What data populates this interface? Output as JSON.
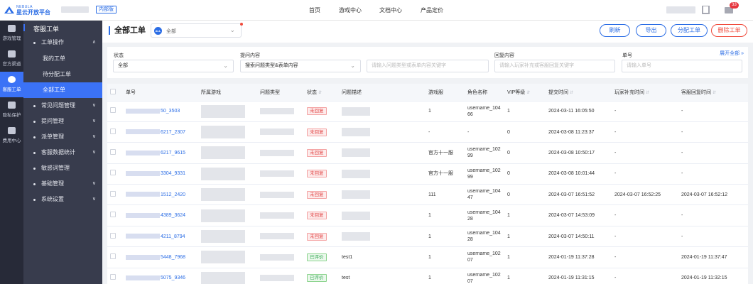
{
  "logo": {
    "line1": "NEBULA",
    "line2": "星云开放平台"
  },
  "top_badge": "内部版",
  "top_nav": [
    "首页",
    "游戏中心",
    "文档中心",
    "产品定价"
  ],
  "notification_count": "33",
  "rail": [
    {
      "label": "游戏管理",
      "icon": "gamepad-icon"
    },
    {
      "label": "官方渠道",
      "icon": "channel-icon"
    },
    {
      "label": "客服工单",
      "icon": "service-icon"
    },
    {
      "label": "隐私保护",
      "icon": "lock-icon"
    },
    {
      "label": "费用中心",
      "icon": "billing-icon"
    }
  ],
  "menu": {
    "title": "客服工单",
    "items": [
      {
        "label": "工单操作",
        "chev": "∧"
      },
      {
        "label": "我的工单",
        "chev": ""
      },
      {
        "label": "待分配工单",
        "chev": ""
      },
      {
        "label": "全部工单",
        "chev": ""
      },
      {
        "label": "常见问题管理",
        "chev": "∨"
      },
      {
        "label": "提问管理",
        "chev": "∨"
      },
      {
        "label": "派单管理",
        "chev": "∨"
      },
      {
        "label": "客服数据统计",
        "chev": "∨"
      },
      {
        "label": "敏感词管理",
        "chev": ""
      },
      {
        "label": "基础管理",
        "chev": "∨"
      },
      {
        "label": "系统设置",
        "chev": "∨"
      }
    ]
  },
  "header": {
    "title": "全部工单",
    "view_icon_text": "ALL",
    "view_value": "全部",
    "buttons": [
      "刷新",
      "导出",
      "分配工单",
      "删除工单"
    ]
  },
  "filters": {
    "expand": "展开全部",
    "status": {
      "label": "状态",
      "value": "全部"
    },
    "question": {
      "label": "提问内容",
      "value": "搜索问题类型&表单内容",
      "placeholder": "请输入问题类型或表单内容关键字"
    },
    "reply": {
      "label": "回复内容",
      "placeholder": "请输入玩家补充或客服回复关键字"
    },
    "order": {
      "label": "单号",
      "placeholder": "请输入单号"
    }
  },
  "table": {
    "columns": [
      "单号",
      "所属游戏",
      "问题类型",
      "状态",
      "问题描述",
      "游戏服",
      "角色名称",
      "VIP等级",
      "提交时间",
      "玩家补充时间",
      "客服回复时间"
    ],
    "rows": [
      {
        "id": "50_3503",
        "status": "未回复",
        "desc": "",
        "server": "1",
        "role": "username_10466",
        "vip": "1",
        "submit": "2024-03-11 16:05:50",
        "supplement": "-",
        "reply": "-"
      },
      {
        "id": "6217_2307",
        "status": "未回复",
        "desc": "",
        "server": "-",
        "role": "-",
        "vip": "0",
        "submit": "2024-03-08 11:23:37",
        "supplement": "-",
        "reply": "-"
      },
      {
        "id": "6217_9615",
        "status": "未回复",
        "desc": "",
        "server": "官方十一服",
        "role": "username_10299",
        "vip": "0",
        "submit": "2024-03-08 10:50:17",
        "supplement": "-",
        "reply": "-"
      },
      {
        "id": "3304_9331",
        "status": "未回复",
        "desc": "",
        "server": "官方十一服",
        "role": "username_10299",
        "vip": "0",
        "submit": "2024-03-08 10:01:44",
        "supplement": "-",
        "reply": "-"
      },
      {
        "id": "1512_2420",
        "status": "未回复",
        "desc": "",
        "server": "111",
        "role": "username_10447",
        "vip": "0",
        "submit": "2024-03-07 16:51:52",
        "supplement": "2024-03-07 16:52:25",
        "reply": "2024-03-07 16:52:12"
      },
      {
        "id": "4389_3624",
        "status": "未回复",
        "desc": "",
        "server": "1",
        "role": "username_10428",
        "vip": "1",
        "submit": "2024-03-07 14:53:09",
        "supplement": "-",
        "reply": "-"
      },
      {
        "id": "4211_8794",
        "status": "未回复",
        "desc": "",
        "server": "1",
        "role": "username_10428",
        "vip": "1",
        "submit": "2024-03-07 14:50:11",
        "supplement": "-",
        "reply": "-"
      },
      {
        "id": "5448_7968",
        "status": "已评价",
        "desc": "test1",
        "server": "1",
        "role": "username_10207",
        "vip": "1",
        "submit": "2024-01-19 11:37:28",
        "supplement": "-",
        "reply": "2024-01-19 11:37:47"
      },
      {
        "id": "5075_9346",
        "status": "已评价",
        "desc": "test",
        "server": "1",
        "role": "username_10207",
        "vip": "1",
        "submit": "2024-01-19 11:31:15",
        "supplement": "-",
        "reply": "2024-01-19 11:32:15"
      }
    ]
  }
}
